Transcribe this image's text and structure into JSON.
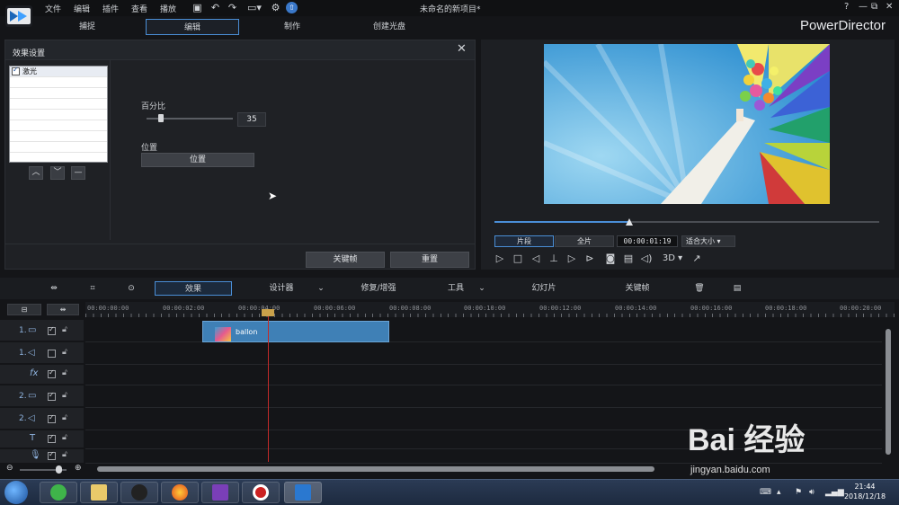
{
  "window": {
    "project_title": "未命名的新项目*",
    "brand": "PowerDirector",
    "help": "?",
    "minimize": "—",
    "restore": "⧉",
    "close": "✕"
  },
  "menu": [
    "文件",
    "编辑",
    "插件",
    "查看",
    "播放"
  ],
  "mode_tabs": [
    {
      "label": "捕捉",
      "active": false
    },
    {
      "label": "编辑",
      "active": true
    },
    {
      "label": "制作",
      "active": false
    },
    {
      "label": "创建光盘",
      "active": false
    }
  ],
  "effect_panel": {
    "title": "效果设置",
    "effect_name": "激光",
    "effect_checked": true,
    "percent_label": "百分比",
    "percent_value": "35",
    "percent_level": 0.35,
    "position_label": "位置",
    "position_button": "位置",
    "keyframe_button": "关键帧",
    "reset_button": "重置"
  },
  "preview": {
    "tab_clip": "片段",
    "tab_movie": "全片",
    "timecode": "00:00:01:19",
    "fit": "适合大小",
    "mode_3d": "3D",
    "progress": 0.35
  },
  "toolbar": {
    "effects": "效果",
    "designer": "设计器",
    "fix_enhance": "修复/增强",
    "tools": "工具",
    "slideshow": "幻灯片",
    "keyframe": "关键帧"
  },
  "ruler": [
    "00:00:00:00",
    "00:00:02:00",
    "00:00:04:00",
    "00:00:06:00",
    "00:00:08:00",
    "00:00:10:00",
    "00:00:12:00",
    "00:00:14:00",
    "00:00:16:00",
    "00:00:18:00",
    "00:00:20:00"
  ],
  "tracks": [
    {
      "label": "1.",
      "icon": "video-track-icon",
      "checked": true
    },
    {
      "label": "1.",
      "icon": "audio-track-icon",
      "checked": false
    },
    {
      "label": "",
      "icon": "fx-track-icon",
      "checked": true
    },
    {
      "label": "2.",
      "icon": "video-track-icon",
      "checked": true
    },
    {
      "label": "2.",
      "icon": "audio-track-icon",
      "checked": true
    },
    {
      "label": "",
      "icon": "title-track-icon",
      "checked": true
    },
    {
      "label": "",
      "icon": "voice-track-icon",
      "checked": true
    }
  ],
  "clip": {
    "name": "ballon"
  },
  "taskbar": {
    "time": "21:44",
    "date": "2018/12/18"
  },
  "watermark": {
    "text": "Bai 经验",
    "sub": "jingyan.baidu.com"
  }
}
